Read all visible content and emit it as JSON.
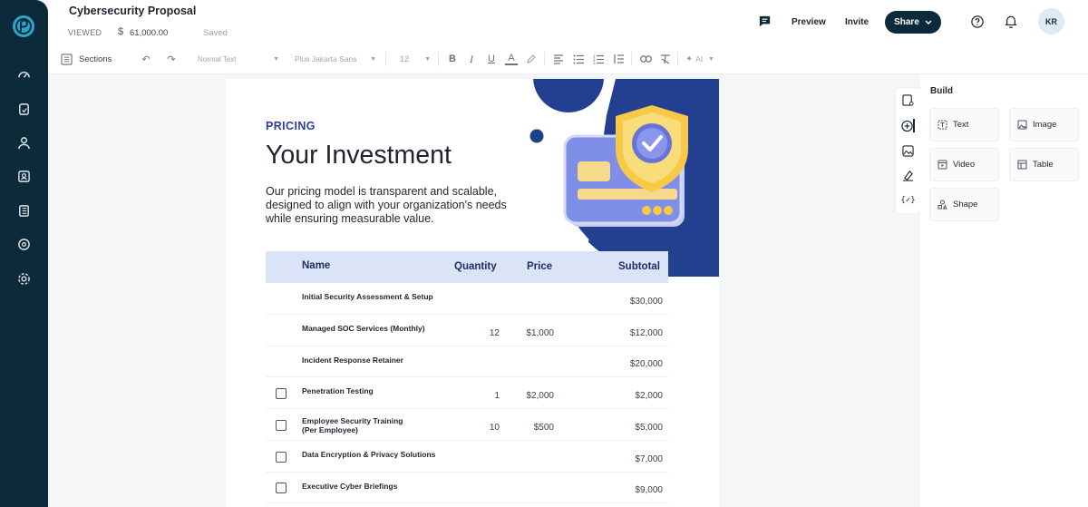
{
  "header": {
    "title": "Cybersecurity Proposal",
    "status": "VIEWED",
    "value": "61,000.00",
    "saved": "Saved",
    "preview_label": "Preview",
    "invite_label": "Invite",
    "share_label": "Share",
    "avatar_initials": "KR"
  },
  "toolbar": {
    "sections_label": "Sections",
    "text_style": "Normal Text",
    "font": "Plus Jakarta Sans",
    "font_size": "12",
    "ai_label": "AI"
  },
  "page": {
    "eyebrow": "PRICING",
    "heading": "Your Investment",
    "intro": "Our pricing model is transparent and scalable, designed to align with your organization's needs while ensuring measurable value."
  },
  "table": {
    "headers": {
      "name": "Name",
      "quantity": "Quantity",
      "price": "Price",
      "subtotal": "Subtotal"
    },
    "rows": [
      {
        "name": "Initial Security Assessment & Setup",
        "quantity": "",
        "price": "",
        "subtotal": "$30,000",
        "checkbox": false
      },
      {
        "name": "Managed SOC Services (Monthly)",
        "quantity": "12",
        "price": "$1,000",
        "subtotal": "$12,000",
        "checkbox": false
      },
      {
        "name": "Incident Response Retainer",
        "quantity": "",
        "price": "",
        "subtotal": "$20,000",
        "checkbox": false
      },
      {
        "name": "Penetration Testing",
        "quantity": "1",
        "price": "$2,000",
        "subtotal": "$2,000",
        "checkbox": true
      },
      {
        "name": "Employee Security Training",
        "name2": "(Per Employee)",
        "quantity": "10",
        "price": "$500",
        "subtotal": "$5,000",
        "checkbox": true
      },
      {
        "name": "Data Encryption & Privacy Solutions",
        "quantity": "",
        "price": "",
        "subtotal": "$7,000",
        "checkbox": true
      },
      {
        "name": "Executive Cyber Briefings",
        "quantity": "",
        "price": "",
        "subtotal": "$9,000",
        "checkbox": true
      }
    ]
  },
  "build": {
    "title": "Build",
    "blocks": [
      {
        "label": "Text",
        "icon": "text-block-icon"
      },
      {
        "label": "Image",
        "icon": "image-block-icon"
      },
      {
        "label": "Video",
        "icon": "video-block-icon"
      },
      {
        "label": "Table",
        "icon": "table-block-icon"
      },
      {
        "label": "Shape",
        "icon": "shape-block-icon"
      }
    ]
  },
  "colors": {
    "rail": "#0d2a3a",
    "accent": "#2b3ea0",
    "table_header": "#dbe3f6",
    "deco_blue": "#233f8f"
  }
}
